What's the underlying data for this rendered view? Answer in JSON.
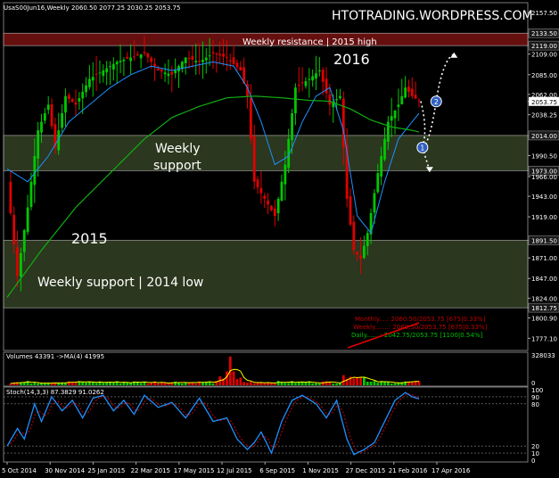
{
  "header": {
    "symbol_line": "UsaS00Jun16,Weekly  2060.50 2077.25 2030.25 2053.75",
    "watermark": "HTOTRADING.WORDPRESS.COM"
  },
  "annotations": {
    "resistance_label": "Weekly resistance | 2015 high",
    "year_2016": "2016",
    "year_2015": "2015",
    "support_mid_line1": "Weekly",
    "support_mid_line2": "support",
    "support_low_label": "Weekly support | 2014 low",
    "marker_1": "1",
    "marker_2": "2",
    "pivot_monthly": "Monthly....: 2060.50/2053.75  [675|0.33%]",
    "pivot_weekly": "Weekly.......: 2060.50/2053.75  [675|0.33%]",
    "pivot_daily": "Daily.......: 2042.75/2053.75  [1100|0.54%]"
  },
  "colors": {
    "background": "#000000",
    "bull_candle": "#00c800",
    "bear_candle": "#e00000",
    "ma_blue": "#1e90ff",
    "ma_green": "#10b010",
    "resistance_zone": "#6b1010",
    "support_zone": "#3a4a28",
    "volume_ma": "#ffff00",
    "stoch_main": "#1e90ff",
    "stoch_signal": "#d00000",
    "pivot_text": "#c00000",
    "pivot_daily_text": "#00c000",
    "projection": "#ffffff",
    "marker_fill": "#3060c0"
  },
  "chart_data": [
    {
      "type": "candlestick",
      "title": "UsaS00Jun16,Weekly",
      "ohlc_last": {
        "open": 2060.5,
        "high": 2077.25,
        "low": 2030.25,
        "close": 2053.75
      },
      "ylim": [
        1766,
        2166
      ],
      "price_ticks": [
        "2157.50",
        "2133.50",
        "2119.00",
        "2109.00",
        "2085.00",
        "2062.00",
        "2053.75",
        "2038.25",
        "2014.00",
        "1990.50",
        "1973.00",
        "1966.00",
        "1943.00",
        "1919.00",
        "1891.50",
        "1871.00",
        "1847.00",
        "1824.00",
        "1812.75",
        "1800.90",
        "1777.10"
      ],
      "x_tick_labels": [
        "5 Oct 2014",
        "30 Nov 2014",
        "25 Jan 2015",
        "22 Mar 2015",
        "17 May 2015",
        "12 Jul 2015",
        "6 Sep 2015",
        "1 Nov 2015",
        "27 Dec 2015",
        "21 Feb 2016",
        "17 Apr 2016"
      ],
      "zones": [
        {
          "name": "Weekly resistance | 2015 high",
          "from": 2119,
          "to": 2133.5
        },
        {
          "name": "Weekly support",
          "from": 1973,
          "to": 2014
        },
        {
          "name": "Weekly support | 2014 low",
          "from": 1812.75,
          "to": 1891.5
        }
      ],
      "close_path_keypoints": [
        [
          0,
          1960
        ],
        [
          3,
          1850
        ],
        [
          6,
          1930
        ],
        [
          9,
          2020
        ],
        [
          12,
          2050
        ],
        [
          14,
          2000
        ],
        [
          17,
          2060
        ],
        [
          20,
          2050
        ],
        [
          24,
          2080
        ],
        [
          28,
          2090
        ],
        [
          32,
          2100
        ],
        [
          36,
          2105
        ],
        [
          40,
          2110
        ],
        [
          44,
          2090
        ],
        [
          48,
          2085
        ],
        [
          52,
          2105
        ],
        [
          56,
          2100
        ],
        [
          60,
          2110
        ],
        [
          64,
          2105
        ],
        [
          68,
          2090
        ],
        [
          70,
          2060
        ],
        [
          72,
          1960
        ],
        [
          75,
          1940
        ],
        [
          78,
          1920
        ],
        [
          81,
          1980
        ],
        [
          84,
          2070
        ],
        [
          88,
          2080
        ],
        [
          91,
          2090
        ],
        [
          94,
          2050
        ],
        [
          97,
          2060
        ],
        [
          99,
          1940
        ],
        [
          101,
          1880
        ],
        [
          103,
          1870
        ],
        [
          105,
          1900
        ],
        [
          108,
          1970
        ],
        [
          111,
          2030
        ],
        [
          114,
          2050
        ],
        [
          116,
          2070
        ],
        [
          118,
          2060
        ],
        [
          120,
          2054
        ]
      ],
      "moving_average_fast_keypoints": [
        [
          0,
          1975
        ],
        [
          6,
          1960
        ],
        [
          12,
          1990
        ],
        [
          18,
          2030
        ],
        [
          24,
          2050
        ],
        [
          30,
          2070
        ],
        [
          36,
          2085
        ],
        [
          42,
          2095
        ],
        [
          48,
          2090
        ],
        [
          54,
          2095
        ],
        [
          60,
          2100
        ],
        [
          66,
          2095
        ],
        [
          70,
          2070
        ],
        [
          74,
          2030
        ],
        [
          78,
          1980
        ],
        [
          82,
          1990
        ],
        [
          86,
          2030
        ],
        [
          90,
          2060
        ],
        [
          94,
          2070
        ],
        [
          98,
          2020
        ],
        [
          102,
          1920
        ],
        [
          106,
          1900
        ],
        [
          110,
          1960
        ],
        [
          114,
          2010
        ],
        [
          118,
          2030
        ],
        [
          120,
          2040
        ]
      ],
      "moving_average_slow_keypoints": [
        [
          0,
          1825
        ],
        [
          10,
          1880
        ],
        [
          20,
          1930
        ],
        [
          30,
          1970
        ],
        [
          40,
          2010
        ],
        [
          48,
          2035
        ],
        [
          56,
          2048
        ],
        [
          64,
          2058
        ],
        [
          72,
          2060
        ],
        [
          80,
          2058
        ],
        [
          88,
          2055
        ],
        [
          94,
          2054
        ],
        [
          100,
          2045
        ],
        [
          106,
          2032
        ],
        [
          112,
          2024
        ],
        [
          118,
          2020
        ],
        [
          120,
          2018
        ]
      ],
      "projection": {
        "marker_1": {
          "bar": 121,
          "price": 2000
        },
        "marker_2": {
          "bar": 125,
          "price": 2053.75
        },
        "down_target": 1973,
        "up_target": 2109
      }
    },
    {
      "type": "bar",
      "title": "Volumes 43391  ->MA(4) 41995",
      "ylim": [
        0,
        328033
      ],
      "y_tick_labels": [
        "328033",
        "0"
      ],
      "series": [
        {
          "name": "Volumes",
          "last": 43391
        },
        {
          "name": "MA(4)",
          "last": 41995
        }
      ]
    },
    {
      "type": "line",
      "title": "Stoch(14,3,3) 87.3829 91.0262",
      "ylim": [
        0,
        100
      ],
      "y_tick_labels": [
        "100",
        "90",
        "80",
        "20",
        "10",
        "0"
      ],
      "series": [
        {
          "name": "main",
          "last": 87.3829,
          "keypoints": [
            [
              0,
              20
            ],
            [
              3,
              45
            ],
            [
              5,
              30
            ],
            [
              8,
              80
            ],
            [
              10,
              55
            ],
            [
              13,
              90
            ],
            [
              16,
              70
            ],
            [
              19,
              85
            ],
            [
              22,
              60
            ],
            [
              25,
              88
            ],
            [
              28,
              92
            ],
            [
              31,
              70
            ],
            [
              34,
              85
            ],
            [
              37,
              65
            ],
            [
              40,
              92
            ],
            [
              44,
              75
            ],
            [
              48,
              82
            ],
            [
              52,
              60
            ],
            [
              56,
              88
            ],
            [
              60,
              55
            ],
            [
              64,
              60
            ],
            [
              67,
              30
            ],
            [
              70,
              15
            ],
            [
              72,
              25
            ],
            [
              74,
              40
            ],
            [
              77,
              10
            ],
            [
              80,
              55
            ],
            [
              83,
              85
            ],
            [
              86,
              92
            ],
            [
              90,
              80
            ],
            [
              93,
              60
            ],
            [
              96,
              85
            ],
            [
              99,
              30
            ],
            [
              101,
              8
            ],
            [
              104,
              15
            ],
            [
              107,
              25
            ],
            [
              110,
              55
            ],
            [
              113,
              85
            ],
            [
              116,
              96
            ],
            [
              118,
              90
            ],
            [
              120,
              87
            ]
          ]
        },
        {
          "name": "signal",
          "last": 91.0262
        }
      ]
    }
  ]
}
